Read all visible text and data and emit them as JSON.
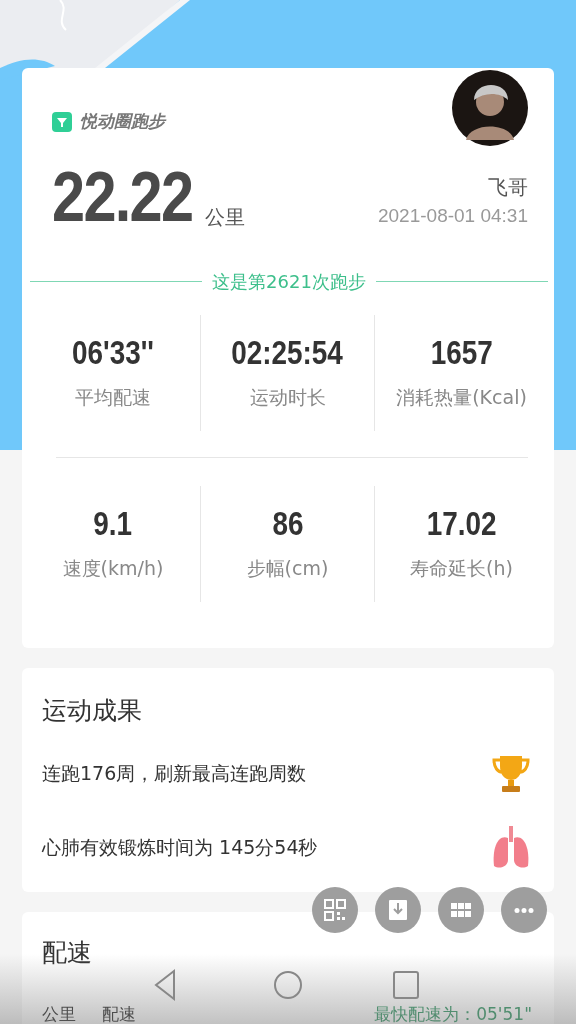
{
  "brand": {
    "name": "悦动圈跑步"
  },
  "summary": {
    "distance": "22.22",
    "unit": "公里",
    "user": "飞哥",
    "datetime": "2021-08-01 04:31",
    "run_count": "这是第2621次跑步"
  },
  "stats": [
    {
      "value": "06'33''",
      "label": "平均配速"
    },
    {
      "value": "02:25:54",
      "label": "运动时长"
    },
    {
      "value": "1657",
      "label": "消耗热量(Kcal)"
    },
    {
      "value": "9.1",
      "label": "速度(km/h)"
    },
    {
      "value": "86",
      "label": "步幅(cm)"
    },
    {
      "value": "17.02",
      "label": "寿命延长(h)"
    }
  ],
  "achievements": {
    "title": "运动成果",
    "items": [
      {
        "text": "连跑176周，刷新最高连跑周数",
        "kind": "trophy"
      },
      {
        "text": "心肺有效锻炼时间为 145分54秒",
        "kind": "lungs"
      }
    ]
  },
  "actions": [
    {
      "kind": "qr"
    },
    {
      "kind": "download"
    },
    {
      "kind": "grid"
    },
    {
      "kind": "more"
    }
  ],
  "pace": {
    "title": "配速",
    "columns": [
      "公里",
      "配速"
    ],
    "fastest": "最快配速为：05'51\""
  },
  "nav": [
    {
      "kind": "back"
    },
    {
      "kind": "home"
    },
    {
      "kind": "recent"
    }
  ]
}
